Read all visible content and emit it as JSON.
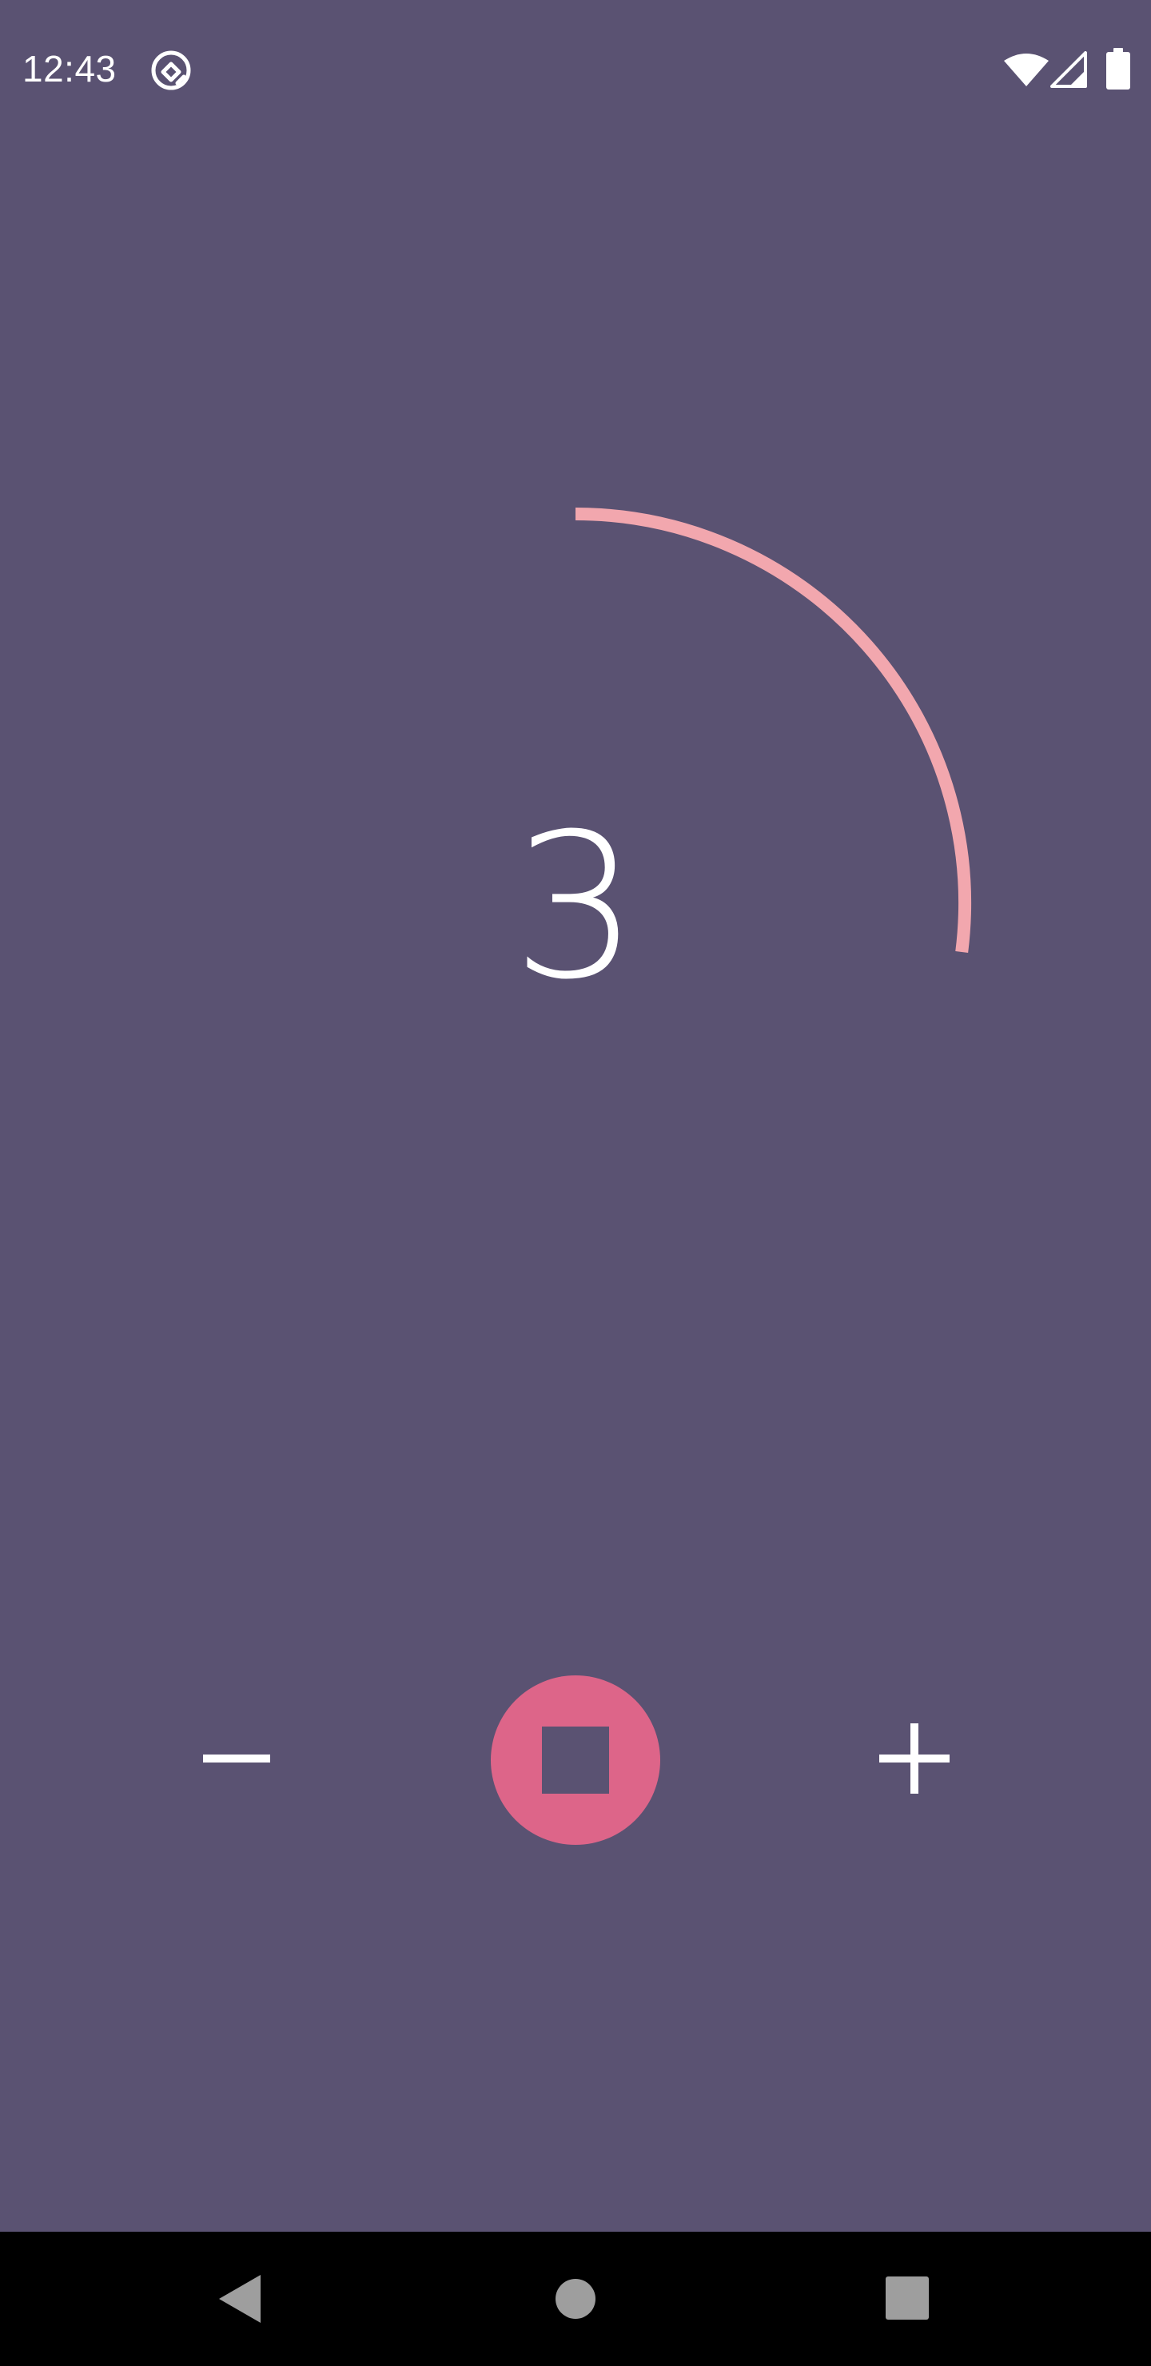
{
  "status_bar": {
    "time": "12:43",
    "icons": [
      "screen-rotation-icon",
      "wifi-icon",
      "cellular-signal-icon",
      "battery-icon"
    ]
  },
  "timer": {
    "count": "3",
    "progress": 0.27
  },
  "controls": {
    "decrement_icon": "minus-icon",
    "stop_icon": "stop-icon",
    "increment_icon": "plus-icon"
  },
  "navigation": {
    "icons": [
      "back-icon",
      "home-icon",
      "recents-icon"
    ]
  },
  "colors": {
    "background": "#5a5272",
    "ring": "#f2a7ae",
    "stop_button": "#dd6589",
    "text": "#ffffff",
    "nav_bar": "#000000",
    "nav_icons": "#9e9e9e"
  }
}
